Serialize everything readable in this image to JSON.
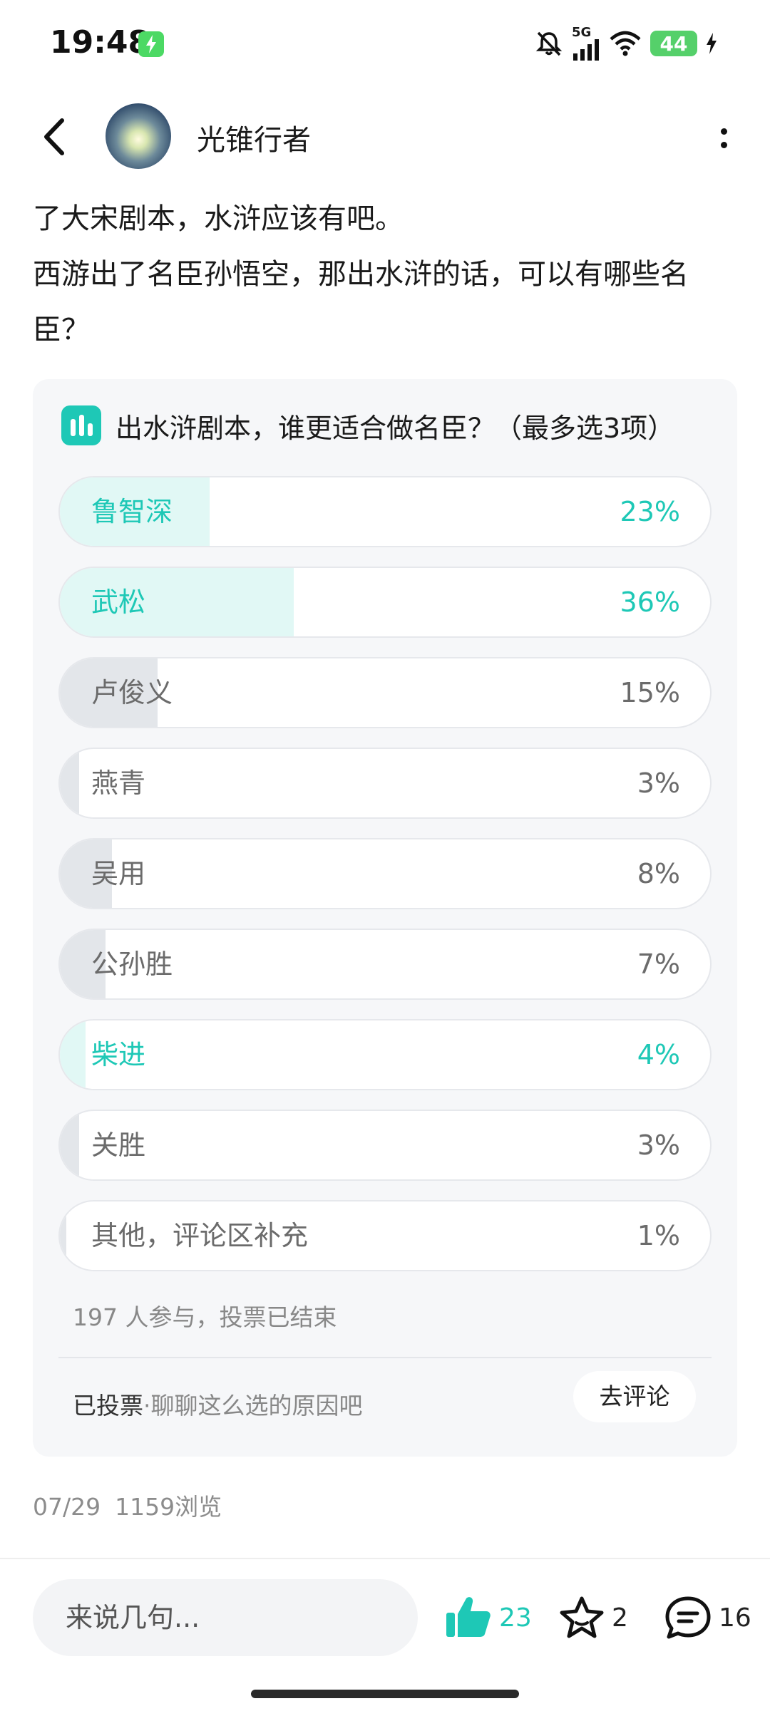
{
  "status_bar": {
    "time": "19:48",
    "network": "5G",
    "battery": "44",
    "icons": [
      "charging-icon",
      "mute-icon",
      "signal-icon",
      "wifi-icon",
      "battery-icon"
    ]
  },
  "header": {
    "username": "光锥行者",
    "icons": [
      "back-arrow-icon",
      "more-vertical-icon"
    ]
  },
  "post": {
    "lines": [
      "了大宋剧本，水浒应该有吧。",
      "西游出了名臣孙悟空，那出水浒的话，可以有哪些名臣？"
    ]
  },
  "poll": {
    "title": "出水浒剧本，谁更适合做名臣？（最多选3项）",
    "icon": "bar-chart-icon",
    "accent_color": "#1ec8b6",
    "options": [
      {
        "label": "鲁智深",
        "percent_text": "23%",
        "percent": 23,
        "voted": true
      },
      {
        "label": "武松",
        "percent_text": "36%",
        "percent": 36,
        "voted": true
      },
      {
        "label": "卢俊义",
        "percent_text": "15%",
        "percent": 15,
        "voted": false
      },
      {
        "label": "燕青",
        "percent_text": "3%",
        "percent": 3,
        "voted": false
      },
      {
        "label": "吴用",
        "percent_text": "8%",
        "percent": 8,
        "voted": false
      },
      {
        "label": "公孙胜",
        "percent_text": "7%",
        "percent": 7,
        "voted": false
      },
      {
        "label": "柴进",
        "percent_text": "4%",
        "percent": 4,
        "voted": true
      },
      {
        "label": "关胜",
        "percent_text": "3%",
        "percent": 3,
        "voted": false
      },
      {
        "label": "其他，评论区补充",
        "percent_text": "1%",
        "percent": 1,
        "voted": false
      }
    ],
    "summary": "197 人参与，投票已结束",
    "footer_strong": "已投票",
    "footer_sep": "·",
    "footer_hint": "聊聊这么选的原因吧",
    "comment_button": "去评论"
  },
  "meta": {
    "date": "07/29",
    "views": "1159浏览"
  },
  "bottom_bar": {
    "input_placeholder": "来说几句...",
    "like_count": "23",
    "star_count": "2",
    "comment_count": "16",
    "icons": [
      "thumbs-up-icon",
      "star-icon",
      "comment-icon"
    ]
  }
}
